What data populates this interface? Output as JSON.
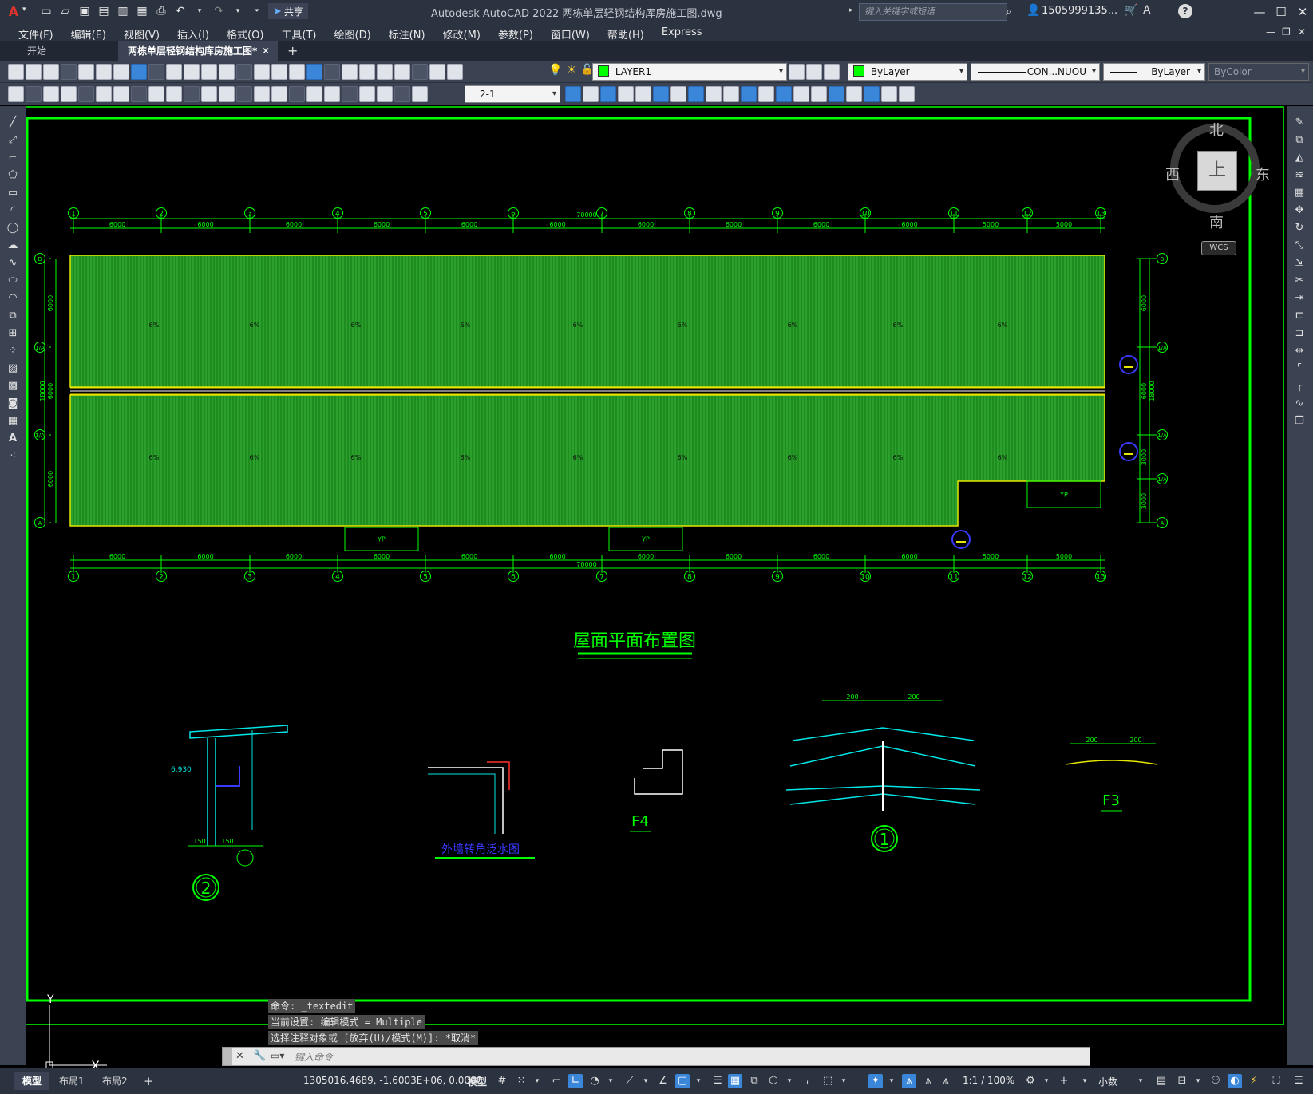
{
  "app": {
    "title": "Autodesk AutoCAD 2022   两栋单层轻钢结构库房施工图.dwg",
    "search_placeholder": "键入关键字或短语",
    "user": "1505999135...",
    "share_label": "共享"
  },
  "menu": [
    "文件(F)",
    "编辑(E)",
    "视图(V)",
    "插入(I)",
    "格式(O)",
    "工具(T)",
    "绘图(D)",
    "标注(N)",
    "修改(M)",
    "参数(P)",
    "窗口(W)",
    "帮助(H)",
    "Express"
  ],
  "tabs": {
    "start": "开始",
    "doc": "两栋单层轻钢结构库房施工图*",
    "close": "✕",
    "new": "+"
  },
  "properties": {
    "layer": "LAYER1",
    "color": "ByLayer",
    "linetype": "CON...NUOU",
    "lineweight": "ByLayer",
    "plotstyle": "ByColor",
    "dimstyle": "2-1"
  },
  "viewcube": {
    "north": "北",
    "south": "南",
    "east": "东",
    "west": "西",
    "top": "上",
    "wcs": "WCS"
  },
  "drawing": {
    "grid_labels": [
      "1",
      "2",
      "3",
      "4",
      "5",
      "6",
      "7",
      "8",
      "9",
      "10",
      "11",
      "12",
      "13"
    ],
    "bay_dims_top": [
      "6000",
      "6000",
      "6000",
      "6000",
      "6000",
      "6000",
      "6000",
      "6000",
      "6000",
      "6000",
      "5000",
      "5000"
    ],
    "bay_dims_bottom": [
      "6000",
      "6000",
      "6000",
      "6000",
      "6000",
      "6000",
      "6000",
      "6000",
      "6000",
      "6000",
      "5000",
      "5000"
    ],
    "total_dim": "70000",
    "row_labels": [
      "B",
      "1/A",
      "1/A",
      "A"
    ],
    "side_dims": [
      "6000",
      "6000",
      "6000",
      "18000"
    ],
    "right_side_dims": [
      "6000",
      "6000",
      "3000",
      "3000",
      "18000"
    ],
    "slope_label": "6%",
    "yp_label": "YP",
    "plan_title": "屋面平面布置图",
    "detail1_label": "1",
    "detail2_label": "2",
    "detail_f4": "F4",
    "detail_f3": "F3",
    "detail_wall_title": "外墙转角泛水图",
    "det2_elev": "6.930",
    "det2_dims": [
      "150",
      "150"
    ],
    "det1_dims": [
      "200",
      "200"
    ],
    "f3_dims": [
      "200",
      "200"
    ]
  },
  "command": {
    "history": [
      "命令: _textedit",
      "当前设置: 编辑模式 = Multiple",
      "选择注释对象或 [放弃(U)/模式(M)]: *取消*"
    ],
    "placeholder": "键入命令"
  },
  "status": {
    "tabs": [
      "模型",
      "布局1",
      "布局2"
    ],
    "add_tab": "+",
    "coords": "1305016.4689, -1.6003E+06, 0.0000",
    "model_label": "模型",
    "scale": "1:1 / 100%",
    "units": "小数"
  },
  "ucs": {
    "x": "X",
    "y": "Y"
  },
  "colors": {
    "drawing_green": "#00ff00",
    "hatch_green": "#1f8f1f",
    "yellow": "#e6e600",
    "cyan": "#00e6e6",
    "accent": "#3a86d8"
  }
}
